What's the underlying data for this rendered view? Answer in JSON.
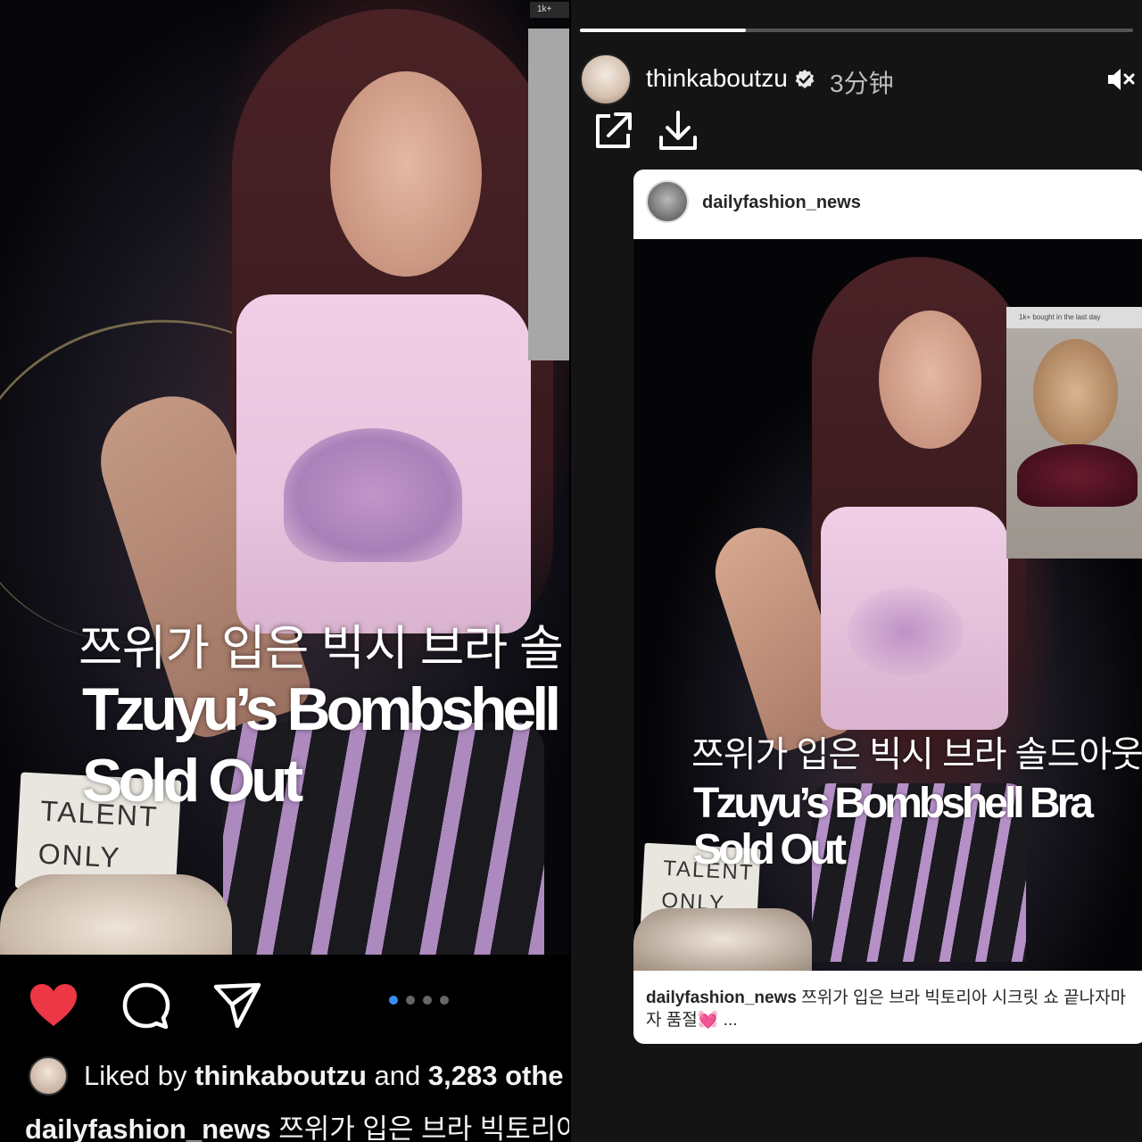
{
  "feed_post": {
    "photo_overlay": {
      "korean_headline": "쯔위가 입은 빅시 브라 솔",
      "english_line1": "Tzuyu’s Bombshell",
      "english_line2": "Sold Out"
    },
    "background_sign": {
      "line1": "TALENT",
      "line2": "ONLY"
    },
    "side_badge": "1k+",
    "carousel": {
      "count": 4,
      "active_index": 0
    },
    "liked_by": {
      "prefix": "Liked by ",
      "user": "thinkaboutzu",
      "middle": " and ",
      "count": "3,283 othe"
    },
    "caption": {
      "username": "dailyfashion_news",
      "text": " 쯔위가 입은 브라 빅토리아"
    },
    "colors": {
      "like_red": "#ed3745",
      "dot_active": "#3b8cf0"
    }
  },
  "story": {
    "username": "thinkaboutzu",
    "time": "3分钟",
    "progress": 0.3,
    "shared_post": {
      "username": "dailyfashion_news",
      "ad_badge": "1k+ bought in the last day",
      "photo_overlay": {
        "korean_headline": "쯔위가 입은 빅시 브라 솔드아웃",
        "english_line1": "Tzuyu’s Bombshell Bra",
        "english_line2": "Sold Out"
      },
      "background_sign": {
        "line1": "TALENT",
        "line2": "ONLY"
      },
      "caption": {
        "username": "dailyfashion_news",
        "text": " 쯔위가 입은 브라 빅토리아 시크릿 쇼 끝나자마자 품절",
        "emoji": "💓",
        "ellipsis": " ..."
      }
    }
  },
  "icons": {
    "left_actions": [
      "heart-icon",
      "comment-icon",
      "share-icon"
    ],
    "story_actions": [
      "external-link-icon",
      "download-icon",
      "mute-icon",
      "verified-badge-icon"
    ]
  }
}
